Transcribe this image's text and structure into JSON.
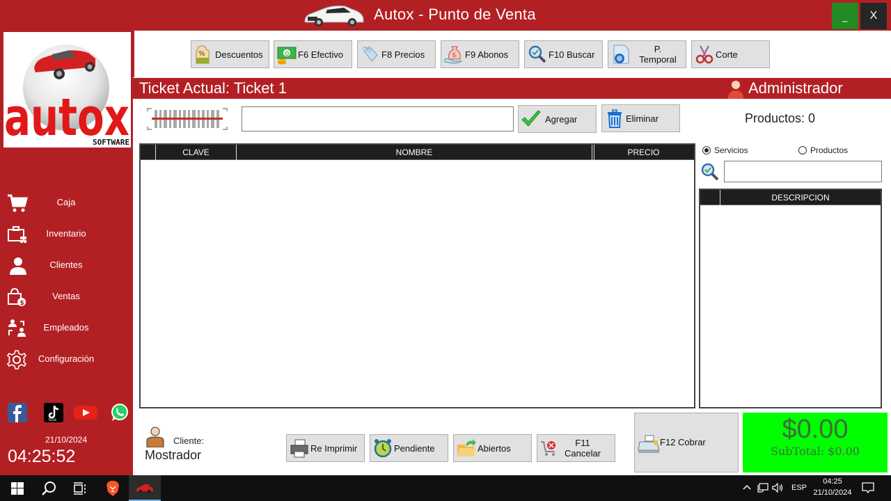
{
  "window": {
    "title": "Autox - Punto de Venta",
    "minimize_label": "_",
    "close_label": "X"
  },
  "sidebar": {
    "logo_text": "autox",
    "logo_sub": "SOFTWARE",
    "items": [
      {
        "label": "Caja",
        "icon": "cart-icon"
      },
      {
        "label": "Inventario",
        "icon": "inventory-icon"
      },
      {
        "label": "Clientes",
        "icon": "user-icon"
      },
      {
        "label": "Ventas",
        "icon": "shopping-bag-dollar-icon"
      },
      {
        "label": "Empleados",
        "icon": "employees-swap-icon"
      },
      {
        "label": "Configuración",
        "icon": "gear-icon"
      }
    ],
    "social": [
      "facebook",
      "tiktok",
      "youtube",
      "whatsapp"
    ],
    "date": "21/10/2024",
    "time": "04:25:52"
  },
  "toolbar": {
    "buttons": [
      {
        "label": "Descuentos",
        "icon": "discount-tag-icon"
      },
      {
        "label": "F6 Efectivo",
        "icon": "cash-icon"
      },
      {
        "label": "F8 Precios",
        "icon": "price-tag-icon"
      },
      {
        "label": "F9 Abonos",
        "icon": "money-bag-icon"
      },
      {
        "label": "F10 Buscar",
        "icon": "search-icon"
      },
      {
        "label": "P. Temporal",
        "icon": "temp-document-icon"
      },
      {
        "label": "Corte",
        "icon": "scissors-icon"
      }
    ]
  },
  "ticket": {
    "title": "Ticket Actual: Ticket 1",
    "user": "Administrador",
    "code_input_value": "",
    "add_label": "Agregar",
    "delete_label": "Eliminar",
    "products_count": "Productos: 0",
    "columns": [
      "CLAVE",
      "NOMBRE",
      "PRECIO"
    ],
    "rows": []
  },
  "side_panel": {
    "radio_options": [
      {
        "label": "Servicios",
        "selected": true
      },
      {
        "label": "Productos",
        "selected": false
      }
    ],
    "search_value": "",
    "columns": [
      "DESCRIPCION"
    ],
    "rows": []
  },
  "bottom": {
    "client_label": "Cliente:",
    "client_name": "Mostrador",
    "buttons": [
      {
        "label": "Re Imprimir",
        "icon": "printer-icon"
      },
      {
        "label": "Pendiente",
        "icon": "alarm-clock-icon"
      },
      {
        "label": "Abiertos",
        "icon": "open-folder-icon"
      },
      {
        "label": "F11 Cancelar",
        "icon": "cancel-cart-icon"
      }
    ],
    "charge_label": "F12 Cobrar",
    "total": "$0.00",
    "subtotal": "SubTotal: $0.00",
    "colors": {
      "total_bg": "#00ff00",
      "accent": "#b32024"
    }
  },
  "taskbar": {
    "language": "ESP",
    "time": "04:25",
    "date": "21/10/2024"
  }
}
